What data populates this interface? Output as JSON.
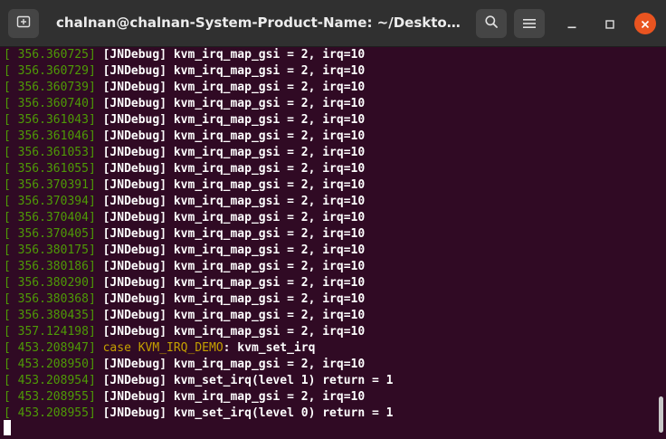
{
  "window": {
    "title": "chalnan@chalnan-System-Product-Name: ~/Desktop/package...",
    "accent": "#e95420",
    "background": "#300a24"
  },
  "icons": {
    "new_tab": "new-tab-icon",
    "search": "search-icon",
    "menu": "hamburger-menu-icon",
    "minimize": "minimize-icon",
    "maximize": "maximize-icon",
    "close": "close-icon"
  },
  "terminal": {
    "lines": [
      {
        "ts": "356.360725",
        "msg": "[JNDebug] kvm_irq_map_gsi = 2, irq=10"
      },
      {
        "ts": "356.360729",
        "msg": "[JNDebug] kvm_irq_map_gsi = 2, irq=10"
      },
      {
        "ts": "356.360739",
        "msg": "[JNDebug] kvm_irq_map_gsi = 2, irq=10"
      },
      {
        "ts": "356.360740",
        "msg": "[JNDebug] kvm_irq_map_gsi = 2, irq=10"
      },
      {
        "ts": "356.361043",
        "msg": "[JNDebug] kvm_irq_map_gsi = 2, irq=10"
      },
      {
        "ts": "356.361046",
        "msg": "[JNDebug] kvm_irq_map_gsi = 2, irq=10"
      },
      {
        "ts": "356.361053",
        "msg": "[JNDebug] kvm_irq_map_gsi = 2, irq=10"
      },
      {
        "ts": "356.361055",
        "msg": "[JNDebug] kvm_irq_map_gsi = 2, irq=10"
      },
      {
        "ts": "356.370391",
        "msg": "[JNDebug] kvm_irq_map_gsi = 2, irq=10"
      },
      {
        "ts": "356.370394",
        "msg": "[JNDebug] kvm_irq_map_gsi = 2, irq=10"
      },
      {
        "ts": "356.370404",
        "msg": "[JNDebug] kvm_irq_map_gsi = 2, irq=10"
      },
      {
        "ts": "356.370405",
        "msg": "[JNDebug] kvm_irq_map_gsi = 2, irq=10"
      },
      {
        "ts": "356.380175",
        "msg": "[JNDebug] kvm_irq_map_gsi = 2, irq=10"
      },
      {
        "ts": "356.380186",
        "msg": "[JNDebug] kvm_irq_map_gsi = 2, irq=10"
      },
      {
        "ts": "356.380290",
        "msg": "[JNDebug] kvm_irq_map_gsi = 2, irq=10"
      },
      {
        "ts": "356.380368",
        "msg": "[JNDebug] kvm_irq_map_gsi = 2, irq=10"
      },
      {
        "ts": "356.380435",
        "msg": "[JNDebug] kvm_irq_map_gsi = 2, irq=10"
      },
      {
        "ts": "357.124198",
        "msg": "[JNDebug] kvm_irq_map_gsi = 2, irq=10"
      },
      {
        "ts": "453.208947",
        "kw": "case KVM_IRQ_DEMO",
        "msg": ": kvm_set_irq"
      },
      {
        "ts": "453.208950",
        "msg": "[JNDebug] kvm_irq_map_gsi = 2, irq=10"
      },
      {
        "ts": "453.208954",
        "msg": "[JNDebug] kvm_set_irq(level 1) return = 1"
      },
      {
        "ts": "453.208955",
        "msg": "[JNDebug] kvm_irq_map_gsi = 2, irq=10"
      },
      {
        "ts": "453.208955",
        "msg": "[JNDebug] kvm_set_irq(level 0) return = 1"
      }
    ]
  }
}
